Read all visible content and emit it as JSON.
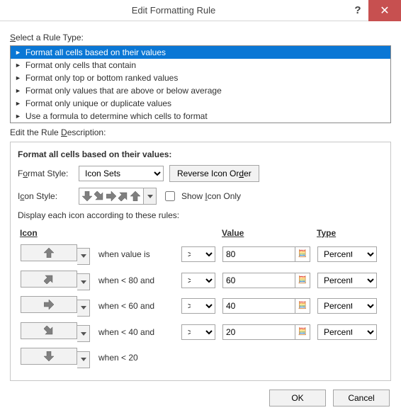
{
  "window": {
    "title": "Edit Formatting Rule",
    "help": "?",
    "close": "✕"
  },
  "rule_type": {
    "label": "Select a Rule Type:",
    "items": [
      "Format all cells based on their values",
      "Format only cells that contain",
      "Format only top or bottom ranked values",
      "Format only values that are above or below average",
      "Format only unique or duplicate values",
      "Use a formula to determine which cells to format"
    ],
    "selected_index": 0
  },
  "description": {
    "label": "Edit the Rule Description:",
    "title": "Format all cells based on their values:",
    "format_style_label": "Format Style:",
    "format_style_value": "Icon Sets",
    "reverse_button": "Reverse Icon Order",
    "icon_style_label": "Icon Style:",
    "show_icon_only_label": "Show Icon Only",
    "show_icon_only_checked": false,
    "display_rules_label": "Display each icon according to these rules:",
    "headers": {
      "icon": "Icon",
      "value": "Value",
      "type": "Type"
    },
    "rows": [
      {
        "icon": "up",
        "condition": "when value is",
        "op": ">=",
        "value": "80",
        "type": "Percentile"
      },
      {
        "icon": "up-right",
        "condition": "when < 80 and",
        "op": ">=",
        "value": "60",
        "type": "Percent"
      },
      {
        "icon": "right",
        "condition": "when < 60 and",
        "op": ">=",
        "value": "40",
        "type": "Percent"
      },
      {
        "icon": "down-right",
        "condition": "when < 40 and",
        "op": ">=",
        "value": "20",
        "type": "Percent"
      },
      {
        "icon": "down",
        "condition": "when < 20",
        "op": "",
        "value": "",
        "type": ""
      }
    ]
  },
  "footer": {
    "ok": "OK",
    "cancel": "Cancel"
  },
  "icons": {
    "up": "up",
    "up-right": "up-right",
    "right": "right",
    "down-right": "down-right",
    "down": "down"
  }
}
